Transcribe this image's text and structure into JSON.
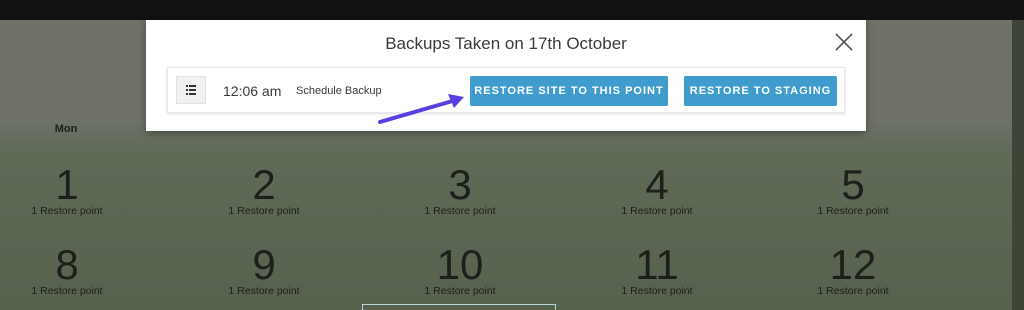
{
  "modal": {
    "title": "Backups Taken on 17th October",
    "backup": {
      "time": "12:06 am",
      "type": "Schedule Backup",
      "restore_site_label": "RESTORE SITE TO THIS POINT",
      "restore_staging_label": "RESTORE TO STAGING"
    }
  },
  "calendar": {
    "day_headers": [
      "Mon"
    ],
    "week1": [
      {
        "day": "1",
        "label": "1 Restore point"
      },
      {
        "day": "2",
        "label": "1 Restore point"
      },
      {
        "day": "3",
        "label": "1 Restore point"
      },
      {
        "day": "4",
        "label": "1 Restore point"
      },
      {
        "day": "5",
        "label": "1 Restore point"
      }
    ],
    "week2": [
      {
        "day": "8",
        "label": "1 Restore point"
      },
      {
        "day": "9",
        "label": "1 Restore point"
      },
      {
        "day": "10",
        "label": "1 Restore point"
      },
      {
        "day": "11",
        "label": "1 Restore point"
      },
      {
        "day": "12",
        "label": "1 Restore point"
      }
    ]
  },
  "colors": {
    "accent": "#3f9ccc",
    "annotation_arrow": "#5a3fe0",
    "overlay": "#6f7268"
  },
  "icons": [
    "list-icon",
    "close-icon",
    "arrow-annotation-icon"
  ]
}
